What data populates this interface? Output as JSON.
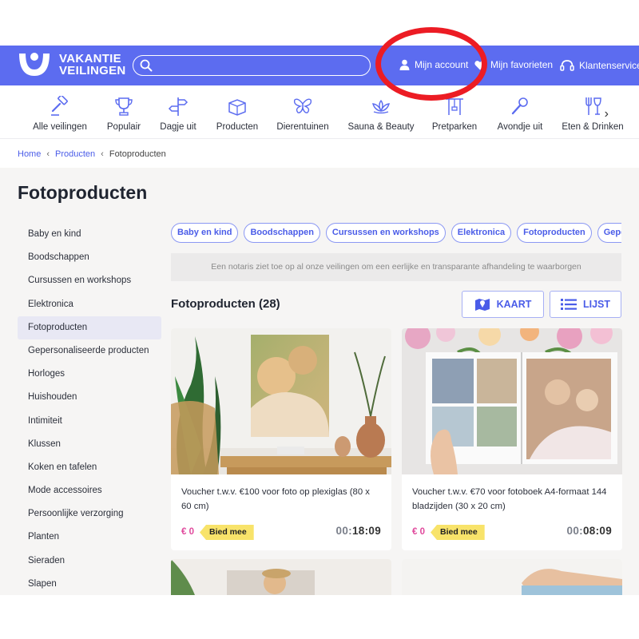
{
  "header": {
    "logo_line1": "VAKANTIE",
    "logo_line2": "VEILINGEN",
    "search_placeholder": "",
    "account_label": "Mijn account",
    "favorites_label": "Mijn favorieten",
    "service_label": "Klantenservice",
    "brand_color": "#5c6cf0"
  },
  "categories": [
    {
      "label": "Alle veilingen",
      "icon": "auction-hammer-icon"
    },
    {
      "label": "Populair",
      "icon": "trophy-icon"
    },
    {
      "label": "Dagje uit",
      "icon": "signpost-icon"
    },
    {
      "label": "Producten",
      "icon": "package-icon"
    },
    {
      "label": "Dierentuinen",
      "icon": "butterfly-icon"
    },
    {
      "label": "Sauna & Beauty",
      "icon": "lotus-icon"
    },
    {
      "label": "Pretparken",
      "icon": "ferris-wheel-icon"
    },
    {
      "label": "Avondje uit",
      "icon": "microphone-icon"
    },
    {
      "label": "Eten & Drinken",
      "icon": "cutlery-icon"
    }
  ],
  "breadcrumb": {
    "home": "Home",
    "products": "Producten",
    "current": "Fotoproducten"
  },
  "page_title": "Fotoproducten",
  "sidebar": [
    "Baby en kind",
    "Boodschappen",
    "Cursussen en workshops",
    "Elektronica",
    "Fotoproducten",
    "Gepersonaliseerde producten",
    "Horloges",
    "Huishouden",
    "Intimiteit",
    "Klussen",
    "Koken en tafelen",
    "Mode accessoires",
    "Persoonlijke verzorging",
    "Planten",
    "Sieraden",
    "Slapen"
  ],
  "sidebar_active": "Fotoproducten",
  "chips": [
    "Baby en kind",
    "Boodschappen",
    "Cursussen en workshops",
    "Elektronica",
    "Fotoproducten",
    "Gepersonaliseerde producten"
  ],
  "notice": "Een notaris ziet toe op al onze veilingen om een eerlijke en transparante afhandeling te waarborgen",
  "results_title": "Fotoproducten (28)",
  "view_map_label": "KAART",
  "view_list_label": "LIJST",
  "products": [
    {
      "title": "Voucher t.w.v. €100 voor foto op plexiglas (80 x 60 cm)",
      "price": "€ 0",
      "bid_label": "Bied mee",
      "timer_prefix": "00:",
      "timer_rest": "18:09"
    },
    {
      "title": "Voucher t.w.v. €70 voor fotoboek A4-formaat 144 bladzijden (30 x 20 cm)",
      "price": "€ 0",
      "bid_label": "Bied mee",
      "timer_prefix": "00:",
      "timer_rest": "08:09"
    }
  ],
  "colors": {
    "accent": "#4a5ce8",
    "price": "#e0489c",
    "bid_badge": "#f8e36a",
    "annotation_ring": "#ec1c24"
  }
}
